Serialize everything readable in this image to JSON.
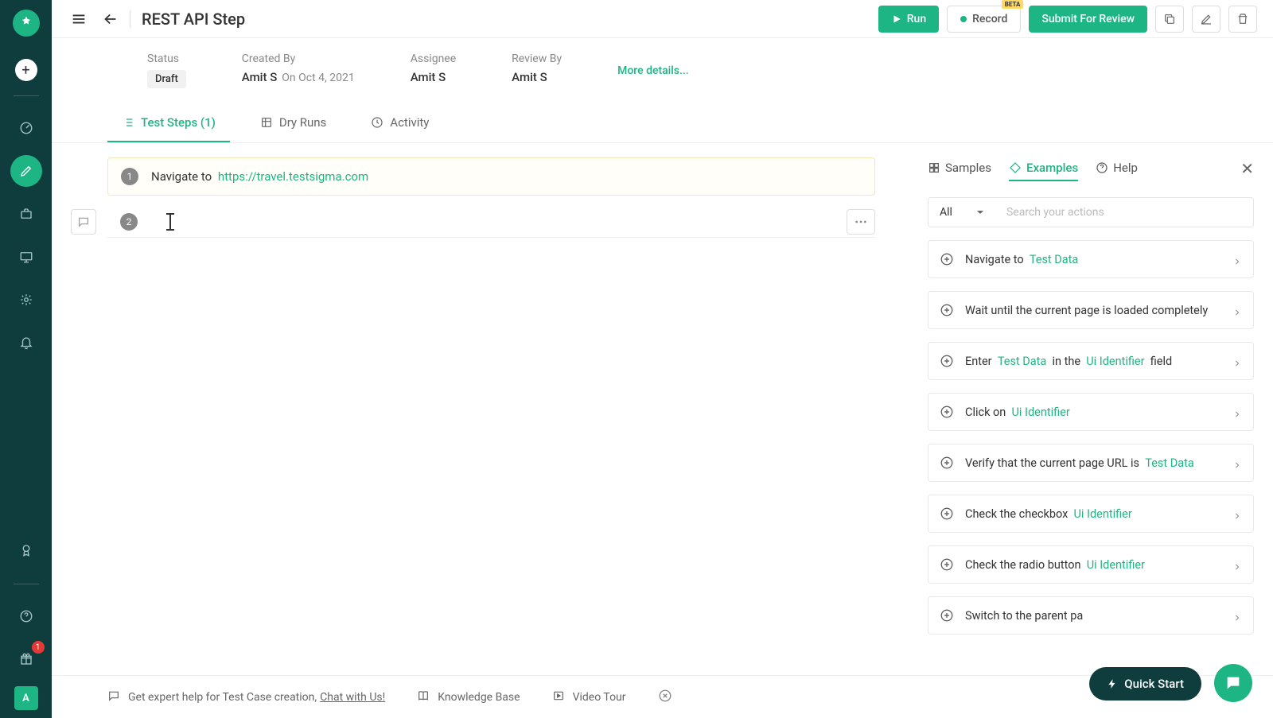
{
  "header": {
    "title": "REST API Step",
    "run": "Run",
    "record": "Record",
    "record_badge": "BETA",
    "submit": "Submit For Review"
  },
  "meta": {
    "status_label": "Status",
    "status_value": "Draft",
    "created_label": "Created By",
    "created_value": "Amit S",
    "created_on": "On Oct 4, 2021",
    "assignee_label": "Assignee",
    "assignee_value": "Amit S",
    "review_label": "Review By",
    "review_value": "Amit S",
    "more": "More details..."
  },
  "tabs": {
    "steps": "Test Steps (1)",
    "dry": "Dry Runs",
    "activity": "Activity"
  },
  "steps": {
    "s1_num": "1",
    "s1_action": "Navigate to",
    "s1_url": "https://travel.testsigma.com",
    "s2_num": "2"
  },
  "panel": {
    "samples": "Samples",
    "examples": "Examples",
    "help": "Help",
    "filter": "All",
    "search_placeholder": "Search your actions"
  },
  "examples": {
    "e0": {
      "pre": "Navigate to",
      "t1": "Test Data"
    },
    "e1": {
      "pre": "Wait until the current page is loaded completely"
    },
    "e2": {
      "pre": "Enter",
      "t1": "Test Data",
      "mid": "in the",
      "t2": "Ui Identifier",
      "post": "field"
    },
    "e3": {
      "pre": "Click on",
      "t1": "Ui Identifier"
    },
    "e4": {
      "pre": "Verify that the current page URL is",
      "t1": "Test Data"
    },
    "e5": {
      "pre": "Check the checkbox",
      "t1": "Ui Identifier"
    },
    "e6": {
      "pre": "Check the radio button",
      "t1": "Ui Identifier"
    },
    "e7": {
      "pre": "Switch to the parent pa"
    }
  },
  "footer": {
    "help_text": "Get expert help for Test Case creation,",
    "chat": "Chat with Us!",
    "kb": "Knowledge Base",
    "tour": "Video Tour"
  },
  "sidebar": {
    "badge": "1",
    "avatar": "A"
  },
  "quick_start": "Quick Start"
}
